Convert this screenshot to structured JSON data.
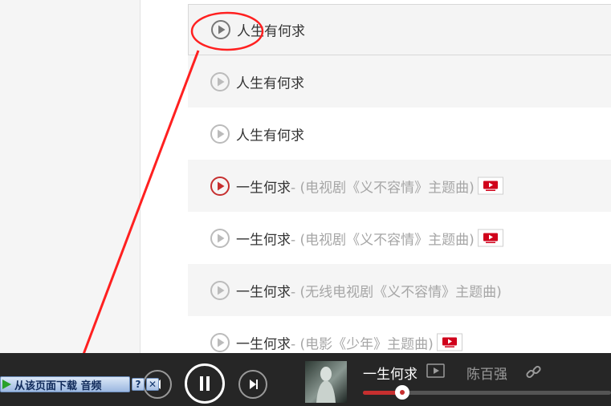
{
  "songs": [
    {
      "title": "人生有何求",
      "sub": "",
      "mv": false,
      "style": "selected",
      "playing": false
    },
    {
      "title": "人生有何求",
      "sub": "",
      "mv": false,
      "style": "alt",
      "playing": false
    },
    {
      "title": "人生有何求",
      "sub": "",
      "mv": false,
      "style": "",
      "playing": false
    },
    {
      "title": "一生何求",
      "sub": " - (电视剧《义不容情》主题曲)",
      "mv": true,
      "style": "alt",
      "playing": true
    },
    {
      "title": "一生何求",
      "sub": " - (电视剧《义不容情》主题曲)",
      "mv": true,
      "style": "",
      "playing": false
    },
    {
      "title": "一生何求",
      "sub": " - (无线电视剧《义不容情》主题曲)",
      "mv": false,
      "style": "alt",
      "playing": false
    },
    {
      "title": "一生何求",
      "sub": " - (电影《少年》主题曲)",
      "mv": true,
      "style": "",
      "playing": false
    }
  ],
  "download_bar": {
    "label": "从该页面下载 音频",
    "help": "?",
    "close": "✕"
  },
  "player": {
    "now_playing_title": "一生何求",
    "artist": "陈百强",
    "progress_fraction": 0.16
  },
  "colors": {
    "accent": "#c62f2f",
    "player_bg": "#262626",
    "annotation": "#ff2020"
  }
}
